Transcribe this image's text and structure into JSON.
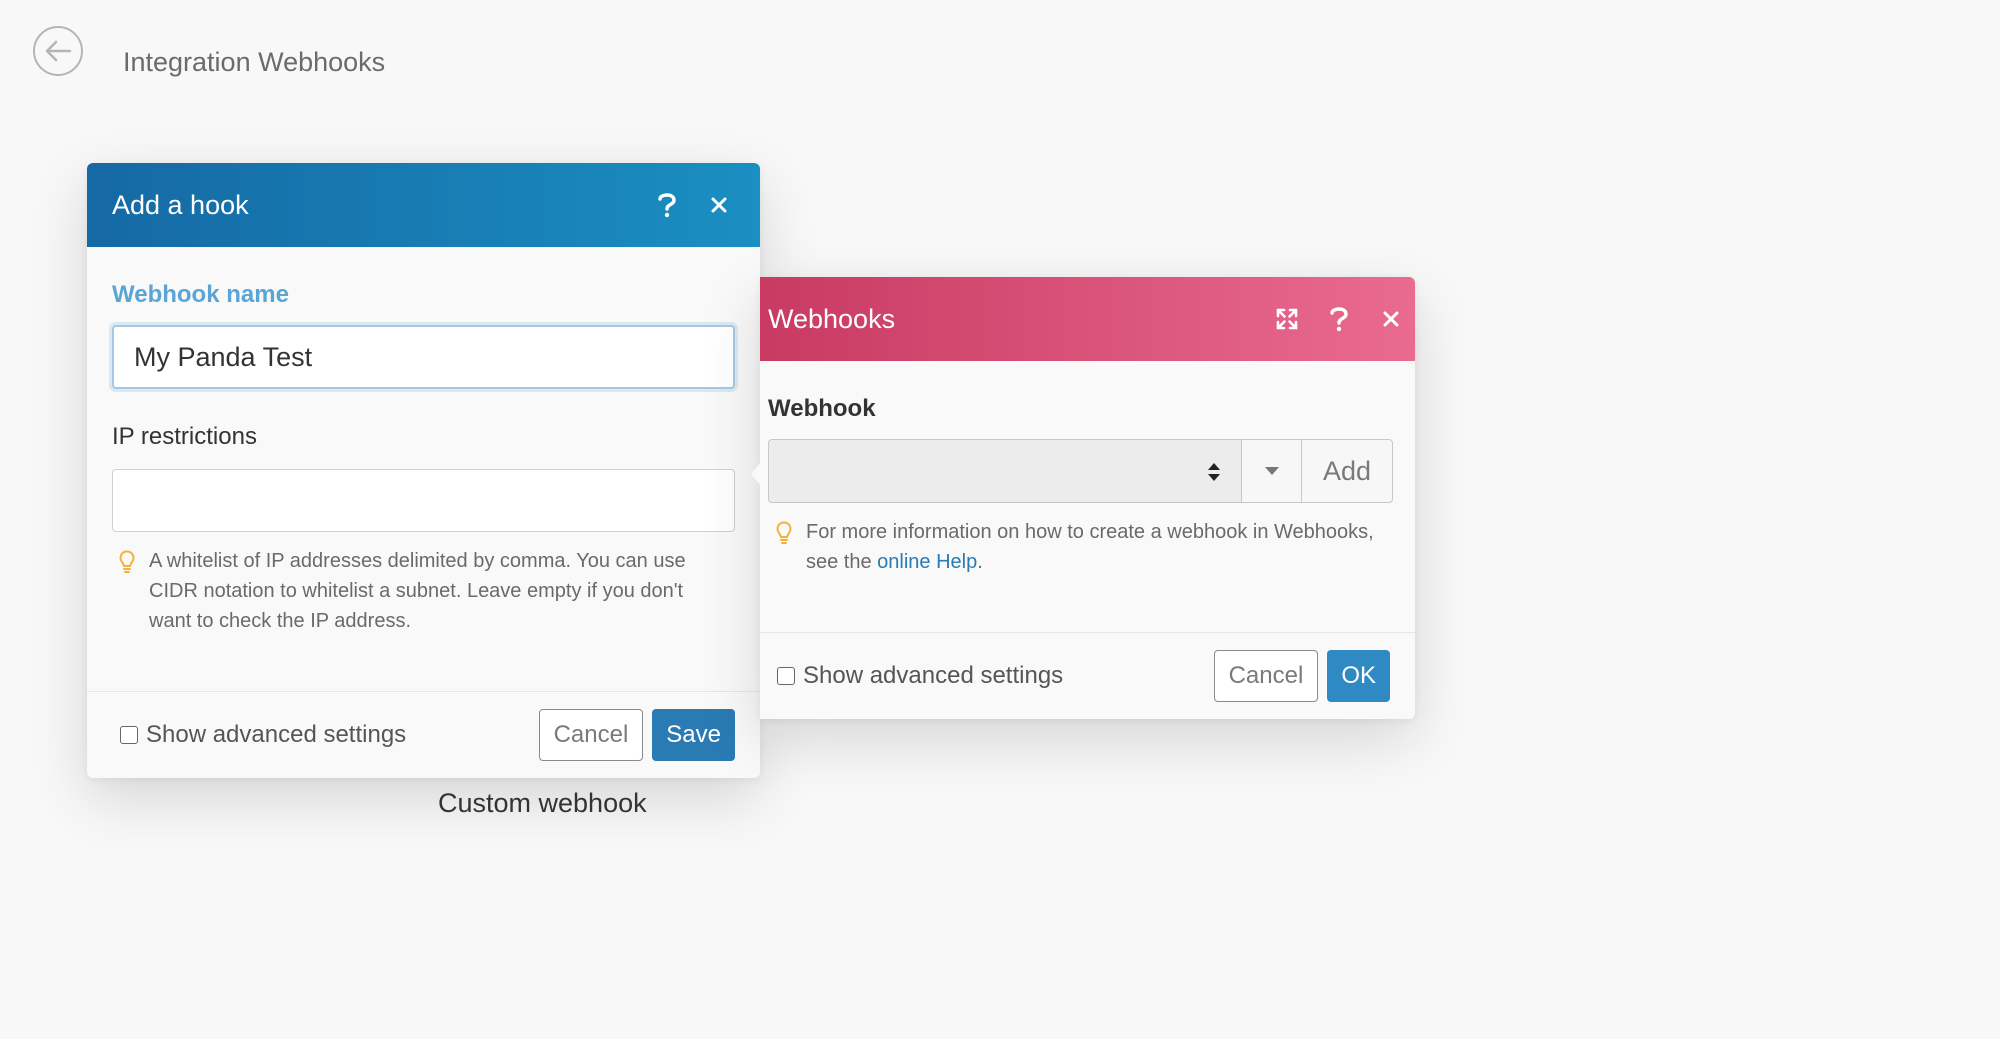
{
  "topbar": {
    "back_icon": "arrow-left-circle-icon",
    "title": "Integration Webhooks"
  },
  "hook_dialog": {
    "title": "Add a hook",
    "accent_color": "#1a7fb8",
    "webhook_name_label": "Webhook name",
    "webhook_name_value": "My Panda Test",
    "ip_label": "IP restrictions",
    "ip_value": "",
    "hint": "A whitelist of IP addresses delimited by comma. You can use CIDR notation to whitelist a subnet. Leave empty if you don't want to check the IP address.",
    "advanced_label": "Show advanced settings",
    "cancel_label": "Cancel",
    "save_label": "Save"
  },
  "module_label": "Custom webhook",
  "webhooks_dialog": {
    "title": "Webhooks",
    "accent_color": "#d9466f",
    "webhook_label": "Webhook",
    "selected_value": "",
    "add_label": "Add",
    "hint_prefix": "For more information on how to create a webhook in Webhooks, see the ",
    "hint_link": "online Help",
    "hint_suffix": ".",
    "advanced_label": "Show advanced settings",
    "cancel_label": "Cancel",
    "ok_label": "OK"
  }
}
